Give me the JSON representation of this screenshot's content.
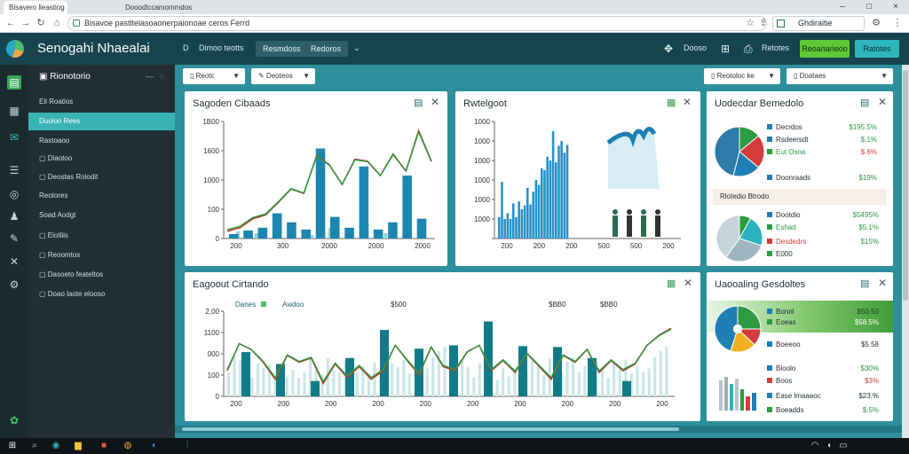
{
  "browser": {
    "tabs": [
      {
        "label": "Bisavero lleastiog",
        "active": true
      },
      {
        "label": "Dooodlccamommdos",
        "active": false
      }
    ],
    "url": "Bisavoe pastltelasoaonerpaionoae ceros Ferrd",
    "right_field": "Ghdiraitie"
  },
  "header": {
    "title": "Senogahi Nhaealai",
    "links": [
      "Dimoo teotts"
    ],
    "pills": [
      "Resmdoss",
      "Redoros"
    ],
    "right_links": [
      "Dooso",
      "Retotes"
    ],
    "green_button": "Reoanarieoo",
    "teal_button": "Ratotes"
  },
  "sidebar": {
    "title": "Rionotorio",
    "items": [
      {
        "label": "Eil Roatios",
        "active": false
      },
      {
        "label": "Duoloo Rees",
        "active": true
      },
      {
        "label": "Rastoaoo",
        "active": false
      },
      {
        "label": "Dlaotoo",
        "active": false
      },
      {
        "label": "Deostas Rolodit",
        "active": false
      },
      {
        "label": "Reotores",
        "active": false
      },
      {
        "label": "Soad Aodgt",
        "active": false
      },
      {
        "label": "Eiotliis",
        "active": false
      },
      {
        "label": "Reoomtos",
        "active": false
      },
      {
        "label": "Dasoeto feateltos",
        "active": false
      },
      {
        "label": "Doao laote elooso",
        "active": false
      }
    ]
  },
  "filters": {
    "left": [
      "Reotc",
      "Deoteos"
    ],
    "right": [
      "Reotoloc ke",
      "Doataes"
    ]
  },
  "panels": {
    "chart1": {
      "title": "Sagoden Cibaads"
    },
    "chart2": {
      "title": "Rwtelgoot"
    },
    "donut": {
      "title": "Uodecdar Bemedolo",
      "legend_a": [
        {
          "label": "Decrdos",
          "value": "$195.5%",
          "color": "#1f7fb3"
        },
        {
          "label": "Rsdeersdt",
          "value": "$.1%",
          "color": "#1f7fb3"
        },
        {
          "label": "Eut Osoa",
          "value": "$.6%",
          "color": "#2e9a41"
        },
        {
          "label": "Doonraads",
          "value": "$19%",
          "color": "#1f7fb3"
        }
      ],
      "subhead": "Rlotedio Btrodo",
      "legend_b": [
        {
          "label": "Dootdio",
          "value": "$5495%",
          "color": "#1f7fb3"
        },
        {
          "label": "Eshad",
          "value": "$5.1%",
          "color": "#2e9a41"
        },
        {
          "label": "Desdedrs",
          "value": "$15%",
          "color": "#d43b3b"
        },
        {
          "label": "E000",
          "value": "",
          "color": "#2e9a41"
        }
      ]
    },
    "chart3": {
      "title": "Eagoout Cirtando",
      "legend": [
        "Danes",
        "Awdoo"
      ],
      "top_values": [
        "$500",
        "$BB0",
        "$BB0"
      ]
    },
    "summary": {
      "title": "Uaooaling Gesdoltes",
      "rows_a": [
        {
          "label": "Bonnl",
          "value": "$50.50",
          "color": "#1f7fb3"
        },
        {
          "label": "Eoeas",
          "value": "$58.5%",
          "color": "#2e9a41"
        },
        {
          "label": "Boeeoo",
          "value": "$5.58",
          "color": "#1f7fb3"
        }
      ],
      "rows_b": [
        {
          "label": "Bloolo",
          "value": "$30%",
          "color": "#2e9a41"
        },
        {
          "label": "Boos",
          "value": "$3%",
          "color": "#d43b3b"
        },
        {
          "label": "Ease lmaaaoc",
          "value": "$23.%",
          "color": "#1f7fb3"
        },
        {
          "label": "Boeadds",
          "value": "$.5%",
          "color": "#2e9a41"
        }
      ]
    }
  },
  "chart_data": [
    {
      "type": "bar",
      "title": "Sagoden Cibaads",
      "y_ticks": [
        "0",
        "100",
        "1000",
        "1600",
        "1B00"
      ],
      "x_ticks": [
        "200",
        "300",
        "2000",
        "2000",
        "2000"
      ],
      "bars": [
        5,
        9,
        12,
        28,
        18,
        10,
        100,
        24,
        12,
        80,
        10,
        18,
        70,
        22
      ],
      "bars_small": [
        8,
        6,
        14,
        9,
        4,
        12,
        9,
        16,
        6,
        11
      ],
      "line": [
        8,
        12,
        22,
        26,
        40,
        55,
        50,
        92,
        82,
        60,
        88,
        86,
        70,
        94,
        75,
        120,
        86
      ]
    },
    {
      "type": "bar",
      "title": "Rwtelgoot",
      "y_ticks": [
        "",
        "1000",
        "1000",
        "1000",
        "1000",
        "1000",
        "1000"
      ],
      "x_ticks": [
        "200",
        "200",
        "200",
        "500",
        "500",
        "200"
      ],
      "bars": [
        22,
        58,
        20,
        26,
        20,
        36,
        22,
        38,
        30,
        34,
        52,
        35,
        48,
        60,
        55,
        72,
        70,
        84,
        80,
        110,
        78,
        95,
        100,
        88,
        96
      ]
    },
    {
      "type": "line",
      "title": "Eagoout Cirtando",
      "y_ticks": [
        "0",
        "100",
        "000",
        "1100",
        "2,00"
      ],
      "x_ticks": [
        "200",
        "200",
        "200",
        "200",
        "200",
        "200",
        "200",
        "200",
        "200",
        "200"
      ],
      "bars": [
        52,
        38,
        18,
        45,
        78,
        56,
        60,
        88,
        59,
        58,
        45,
        18
      ],
      "line": [
        30,
        62,
        55,
        40,
        20,
        48,
        40,
        45,
        15,
        38,
        22,
        35,
        20,
        30,
        60,
        42,
        25,
        58,
        35,
        30,
        52,
        60,
        30,
        42,
        28,
        50,
        35,
        20,
        48,
        40,
        55,
        28,
        42,
        30,
        38,
        60,
        72,
        80
      ]
    },
    {
      "type": "pie",
      "title": "Uodecdar Bemedolo",
      "values": [
        14,
        22,
        18,
        46
      ],
      "colors": [
        "#2e9a41",
        "#d43b3b",
        "#1f7fb3",
        "#2e7aa8"
      ]
    },
    {
      "type": "pie",
      "values": [
        8,
        22,
        30,
        40
      ],
      "colors": [
        "#2e9a41",
        "#2bb3c0",
        "#9fb6c2",
        "#c7d3da"
      ]
    },
    {
      "type": "pie",
      "values": [
        25,
        12,
        18,
        45
      ],
      "colors": [
        "#2e9a41",
        "#d43b3b",
        "#f2b01e",
        "#1f7fb3"
      ]
    }
  ]
}
